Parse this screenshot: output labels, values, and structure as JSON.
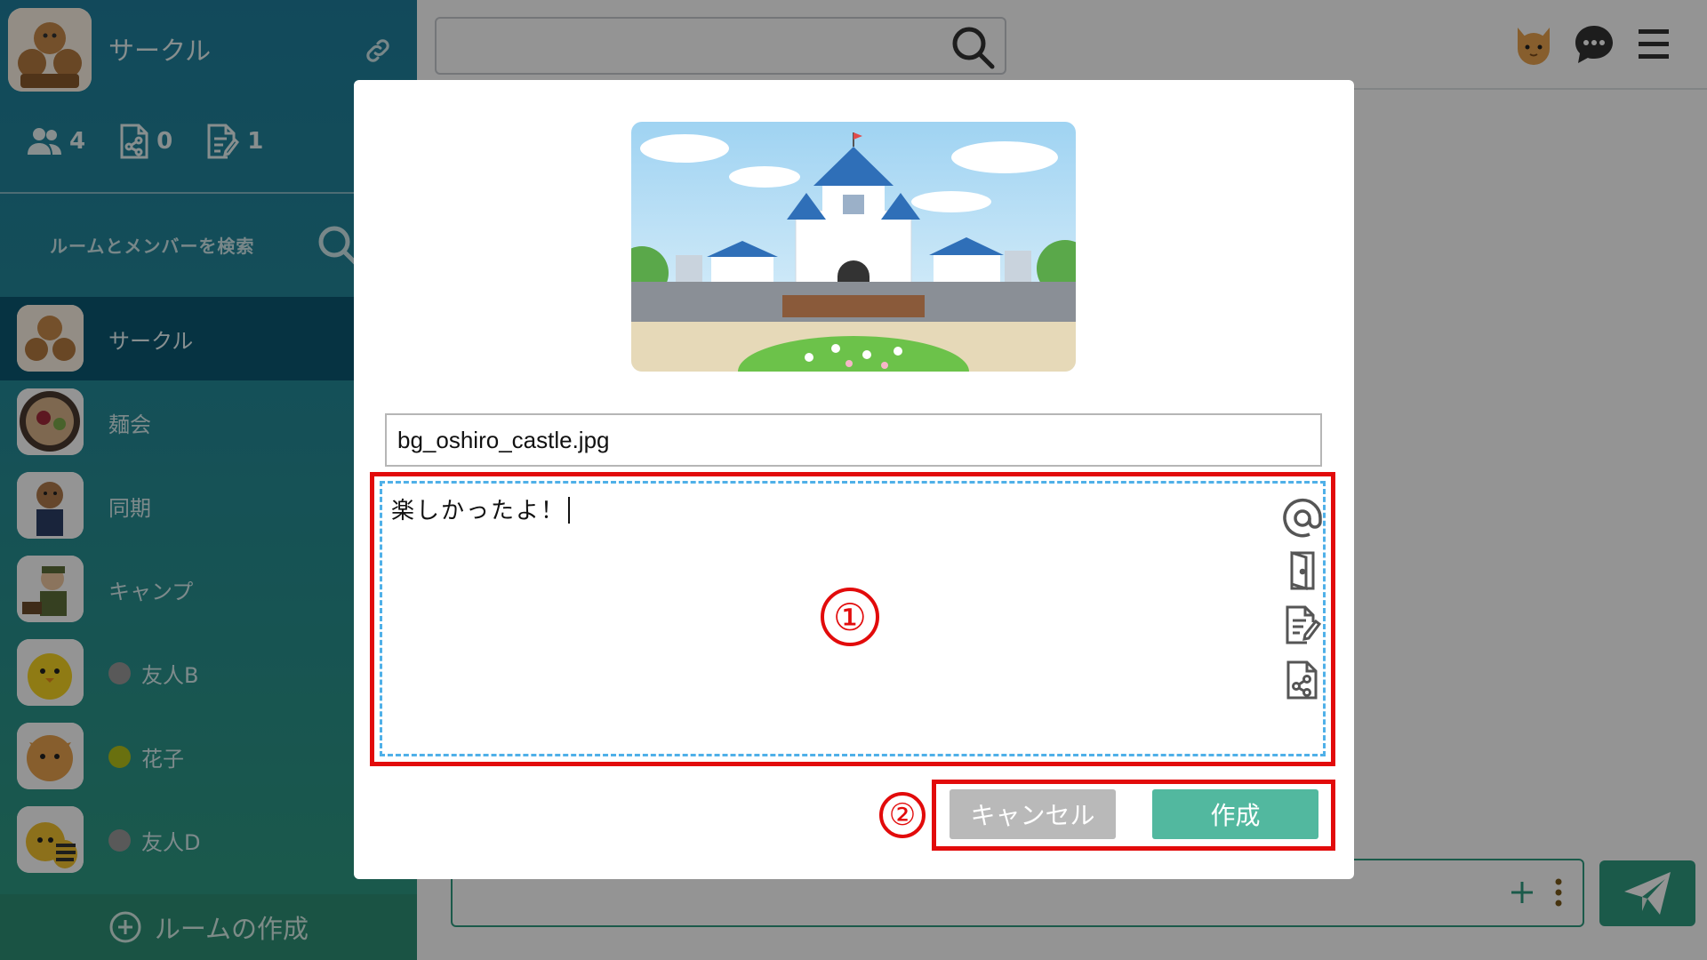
{
  "sidebar": {
    "group_title": "サークル",
    "stats": [
      {
        "icon": "members-icon",
        "value": "4"
      },
      {
        "icon": "shared-file-icon",
        "value": "0"
      },
      {
        "icon": "edit-doc-icon",
        "value": "1"
      }
    ],
    "search_label": "ルームとメンバーを検索",
    "rooms": [
      {
        "name": "サークル",
        "active": true
      },
      {
        "name": "麺会"
      },
      {
        "name": "同期"
      },
      {
        "name": "キャンプ"
      },
      {
        "name": "友人B",
        "status_color": "#9a9a9a"
      },
      {
        "name": "花子",
        "status_color": "#b6c21a"
      },
      {
        "name": "友人D",
        "status_color": "#9a9a9a"
      }
    ],
    "create_room_label": "ルームの作成"
  },
  "modal": {
    "filename_value": "bg_oshiro_castle.jpg",
    "message_value": "楽しかったよ！",
    "annotation_1": "①",
    "annotation_2": "②",
    "cancel_label": "キャンセル",
    "create_label": "作成"
  },
  "colors": {
    "accent": "#2f9c80",
    "create_button": "#52b89f",
    "cancel_button": "#b9b9b9",
    "highlight": "#e20b0b",
    "dashed_focus": "#4fb0e8"
  }
}
